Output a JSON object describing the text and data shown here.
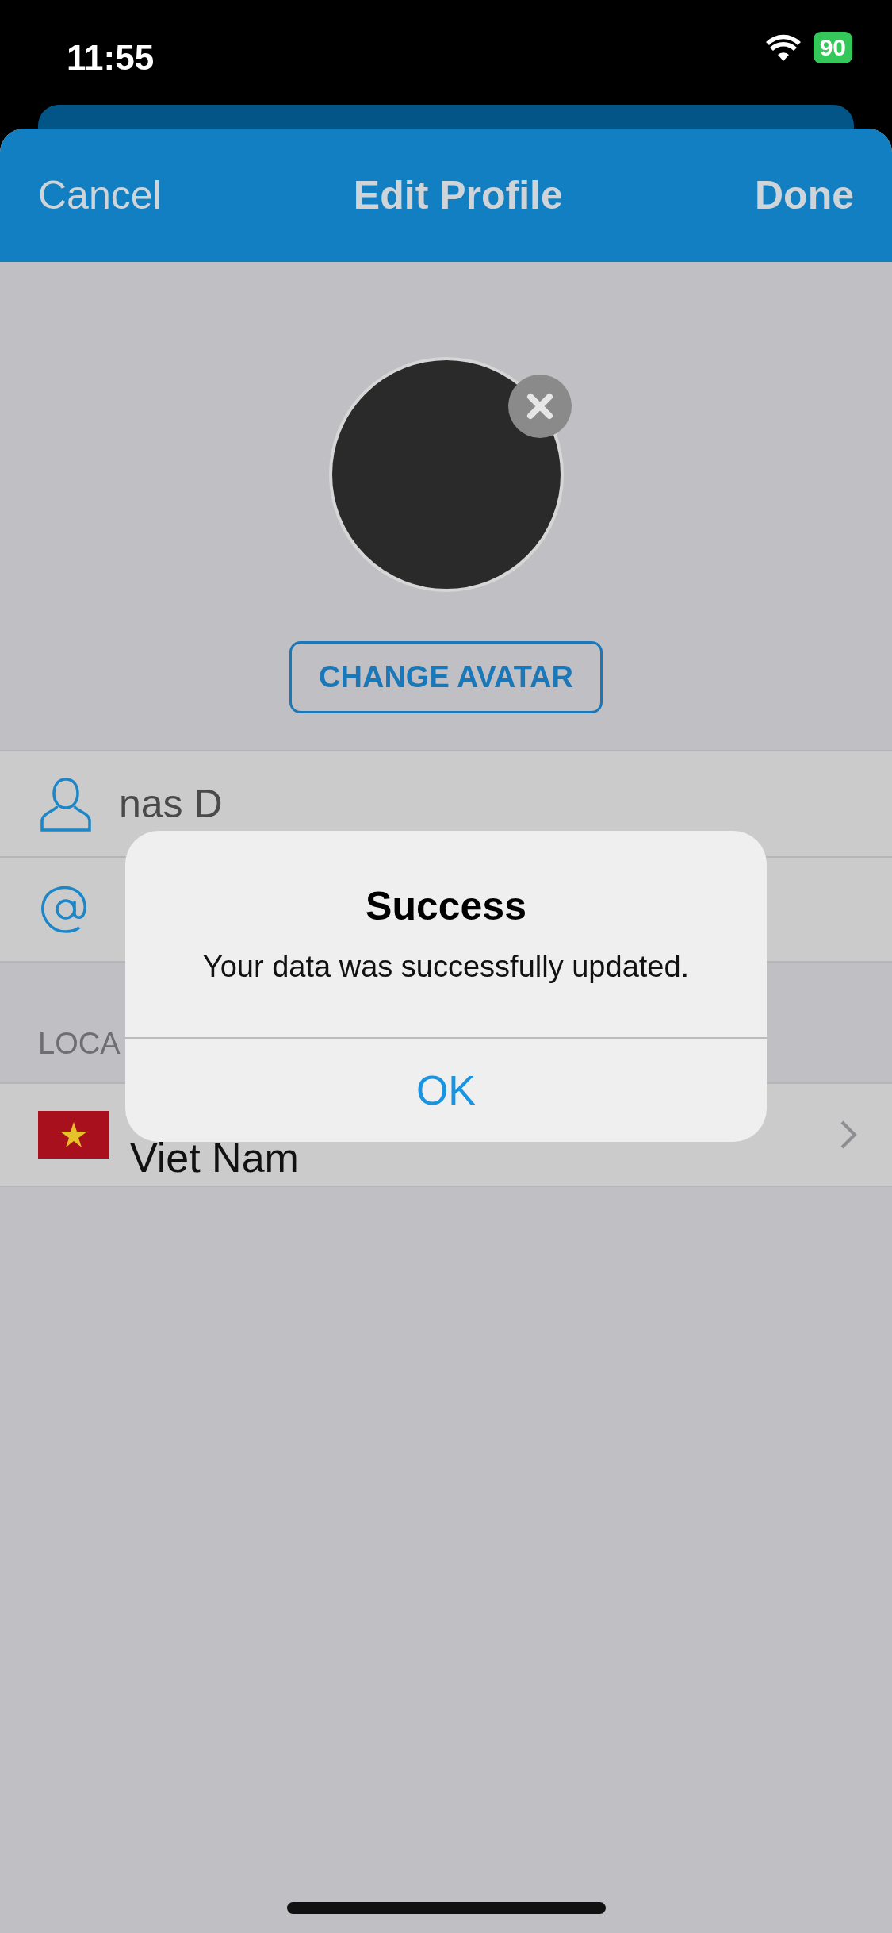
{
  "status_bar": {
    "time": "11:55",
    "battery": "90"
  },
  "nav": {
    "cancel": "Cancel",
    "title": "Edit Profile",
    "done": "Done"
  },
  "change_avatar_button": "CHANGE AVATAR",
  "fields": [
    {
      "kind": "name",
      "value": "nas D"
    },
    {
      "kind": "email"
    }
  ],
  "location_section": {
    "header": "LOCA",
    "country": "Viet Nam"
  },
  "alert": {
    "title": "Success",
    "message": "Your data was successfully updated.",
    "button": "OK"
  }
}
